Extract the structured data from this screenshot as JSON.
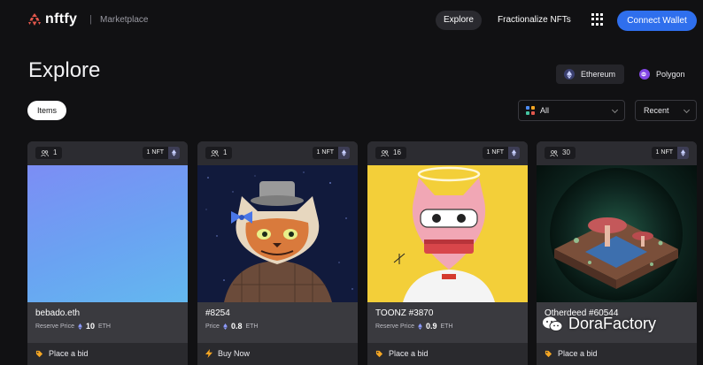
{
  "nav": {
    "brand": "nftfy",
    "separator": "|",
    "section": "Marketplace",
    "links": [
      "Explore",
      "Fractionalize NFTs"
    ],
    "apps_icon": "grid-icon",
    "connect_label": "Connect Wallet"
  },
  "page": {
    "title": "Explore",
    "chains": [
      {
        "label": "Ethereum",
        "icon": "ethereum-icon",
        "color": "#627eea"
      },
      {
        "label": "Polygon",
        "icon": "polygon-icon",
        "color": "#8247e5"
      }
    ],
    "tab": "Items",
    "filter_select": "All",
    "sort_select": "Recent"
  },
  "cards": [
    {
      "owners": "1",
      "badge": "1 NFT",
      "name": "bebado.eth",
      "price_label": "Reserve Price",
      "price": "10",
      "unit": "ETH",
      "action": "Place a bid",
      "action_icon": "tag-icon"
    },
    {
      "owners": "1",
      "badge": "1 NFT",
      "name": "#8254",
      "price_label": "Price",
      "price": "0.8",
      "unit": "ETH",
      "action": "Buy Now",
      "action_icon": "lightning-icon"
    },
    {
      "owners": "16",
      "badge": "1 NFT",
      "name": "TOONZ #3870",
      "price_label": "Reserve Price",
      "price": "0.9",
      "unit": "ETH",
      "action": "Place a bid",
      "action_icon": "tag-icon"
    },
    {
      "owners": "30",
      "badge": "1 NFT",
      "name": "Otherdeed #60544",
      "price_label": "",
      "price": "",
      "unit": "",
      "action": "Place a bid",
      "action_icon": "tag-icon"
    }
  ],
  "watermark": "DoraFactory",
  "colors": {
    "accent": "#2f6fed",
    "background": "#111113",
    "card": "#3a3a3f",
    "tag": "#f5a623"
  }
}
